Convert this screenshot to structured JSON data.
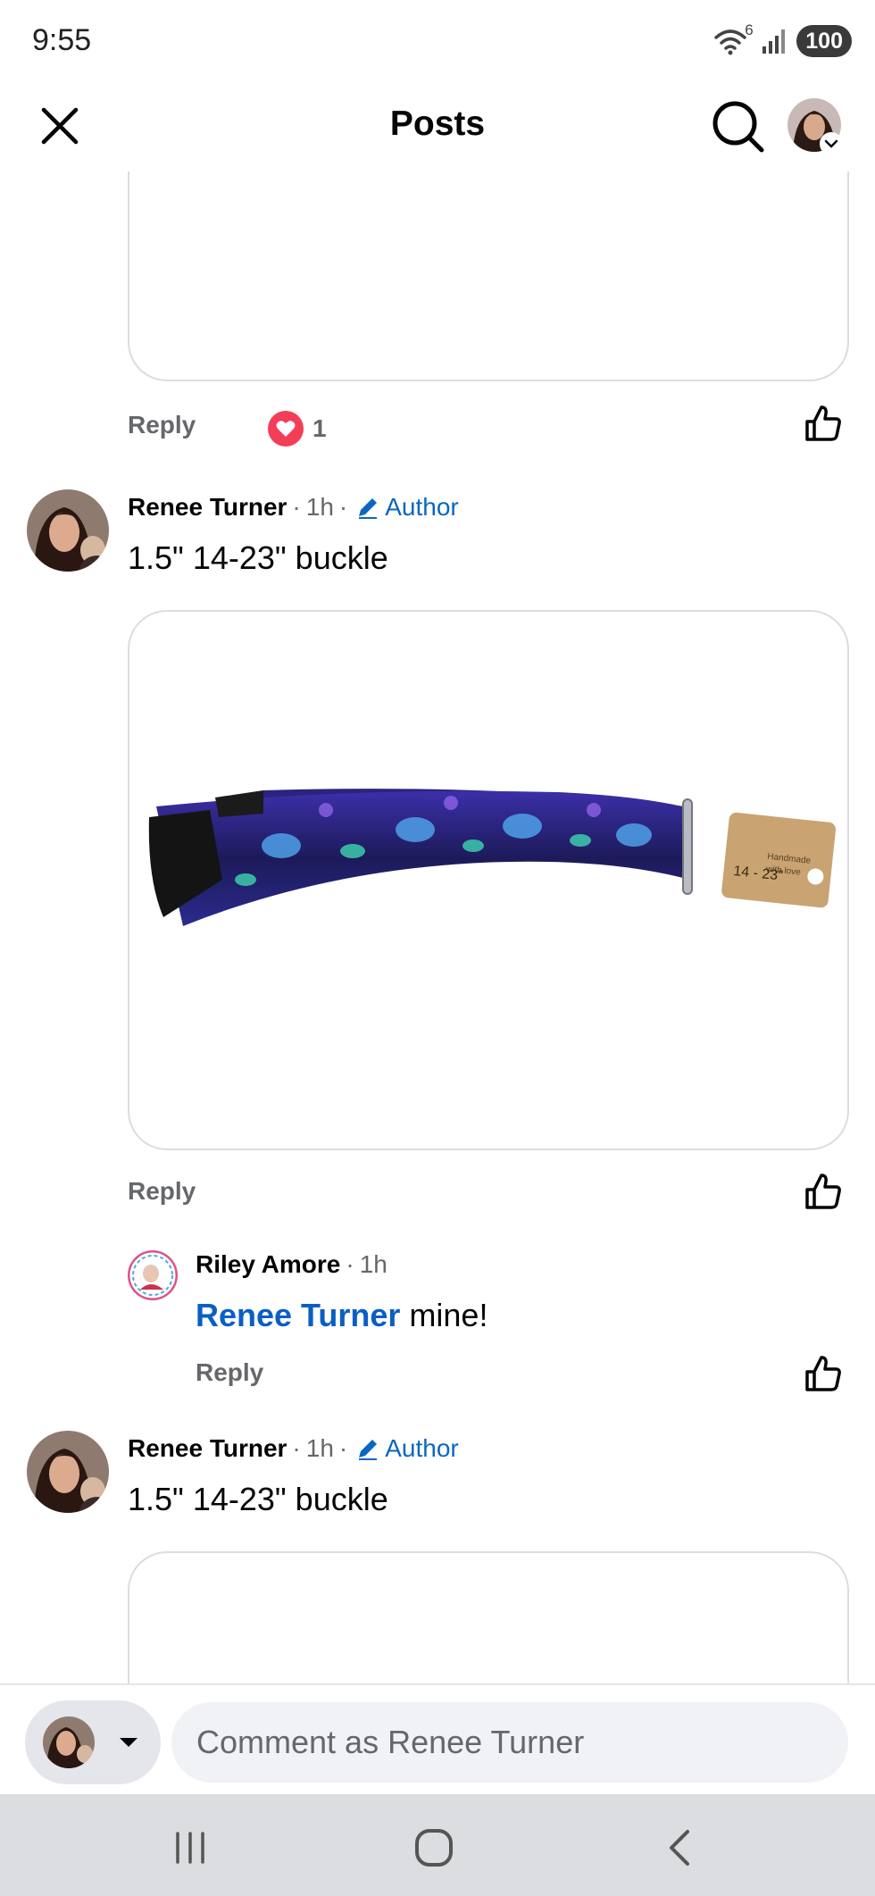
{
  "status_bar": {
    "time": "9:55",
    "wifi_label": "6",
    "battery": "100"
  },
  "header": {
    "title": "Posts",
    "close_icon": "close-icon",
    "search_icon": "search-icon"
  },
  "comments": [
    {
      "reply_label": "Reply",
      "reaction_count": "1",
      "reaction_type": "love"
    },
    {
      "author": "Renee Turner",
      "time": "1h",
      "badge": "Author",
      "text": "1.5\" 14-23\" buckle",
      "reply_label": "Reply",
      "image_tag_lines": [
        "Handmade",
        "with love"
      ],
      "image_tag_size": "14 - 23\""
    },
    {
      "author": "Riley Amore",
      "time": "1h",
      "mention": "Renee Turner",
      "text": "mine!",
      "reply_label": "Reply"
    },
    {
      "author": "Renee Turner",
      "time": "1h",
      "badge": "Author",
      "text": "1.5\" 14-23\" buckle"
    }
  ],
  "composer": {
    "placeholder": "Comment as Renee Turner"
  },
  "colors": {
    "link_blue": "#0a66c2",
    "secondary_text": "#65676b",
    "love_red": "#f33e58",
    "nav_bar_bg": "#dcdde0"
  }
}
